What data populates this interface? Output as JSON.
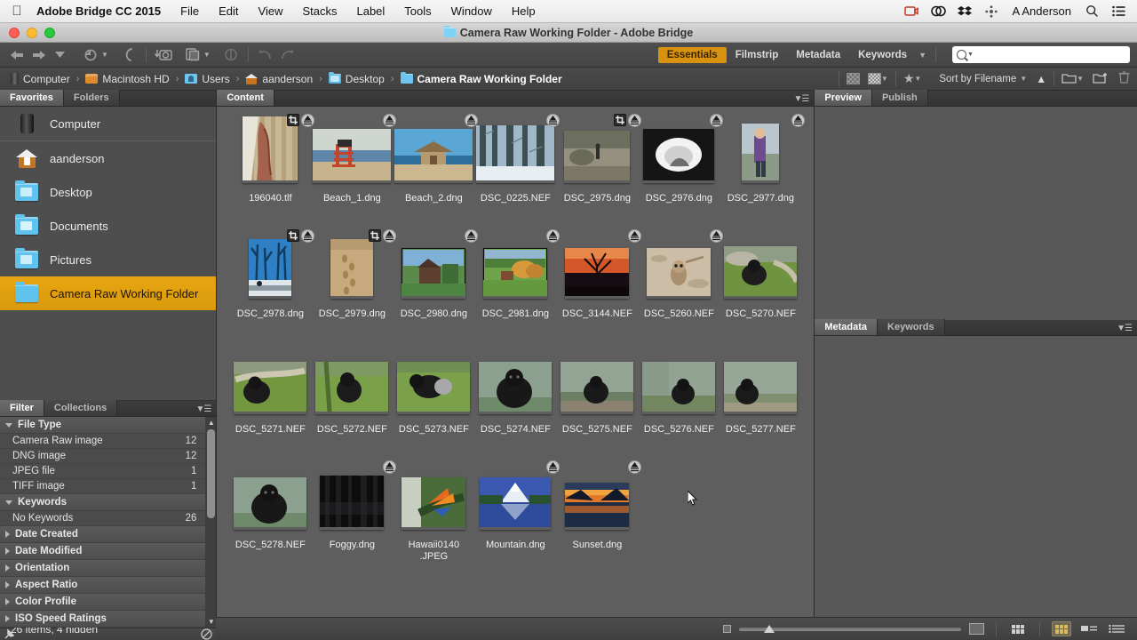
{
  "menubar": {
    "apple_icon": "apple-icon",
    "app_name": "Adobe Bridge CC 2015",
    "items": [
      "File",
      "Edit",
      "View",
      "Stacks",
      "Label",
      "Tools",
      "Window",
      "Help"
    ],
    "status_icons": [
      "video-capture-icon",
      "creative-cloud-icon",
      "dropbox-icon",
      "network-icon"
    ],
    "user": "A Anderson",
    "search_icon": "spotlight-search-icon",
    "notification_icon": "notification-center-icon"
  },
  "window": {
    "title": "Camera Raw Working Folder - Adobe Bridge",
    "folder_icon": "folder-icon",
    "close_label": "close-button",
    "minimize_label": "minimize-button",
    "zoom_label": "zoom-button"
  },
  "toolbar": {
    "back_icon": "back-arrow-icon",
    "forward_icon": "forward-arrow-icon",
    "recent_icon": "recent-dropdown-icon",
    "revert_icon": "revert-icon",
    "boomerang_icon": "return-icon",
    "camera_icon": "get-photos-from-camera-icon",
    "refine_icon": "refine-icon",
    "rotate_ccw_icon": "rotate-counterclockwise-icon",
    "rotate_cw_icon": "rotate-clockwise-icon",
    "open_recent_icon": "open-recent-icon",
    "workspaces": [
      {
        "label": "Essentials",
        "active": true
      },
      {
        "label": "Filmstrip",
        "active": false
      },
      {
        "label": "Metadata",
        "active": false
      },
      {
        "label": "Keywords",
        "active": false
      }
    ],
    "workspace_more_icon": "chevron-down-icon",
    "search_placeholder": "",
    "search_value": "",
    "search_icon": "search-icon"
  },
  "pathbar": {
    "crumbs": [
      {
        "label": "Computer",
        "icon": "computer-icon"
      },
      {
        "label": "Macintosh HD",
        "icon": "harddrive-icon"
      },
      {
        "label": "Users",
        "icon": "users-folder-icon"
      },
      {
        "label": "aanderson",
        "icon": "home-icon"
      },
      {
        "label": "Desktop",
        "icon": "desktop-folder-icon"
      },
      {
        "label": "Camera Raw Working Folder",
        "icon": "folder-icon"
      }
    ],
    "separator": "›",
    "filter_icon": "filter-unrated-icon",
    "filter_dropdown_icon": "filter-dropdown-icon",
    "rating_icon": "star-rating-icon",
    "rating_dropdown_icon": "rating-dropdown-icon",
    "sort_label": "Sort by Filename",
    "sort_dropdown_icon": "chevron-down-icon",
    "sort_direction_icon": "ascending-arrow-icon",
    "new_folder_icon": "new-folder-icon",
    "open_in_icon": "open-in-icon",
    "delete_icon": "trash-icon"
  },
  "sidebar": {
    "tabs": [
      {
        "label": "Favorites",
        "active": true
      },
      {
        "label": "Folders",
        "active": false
      }
    ],
    "items": [
      {
        "label": "Computer",
        "icon": "computer-icon",
        "selected": false
      },
      {
        "label": "aanderson",
        "icon": "home-icon",
        "selected": false
      },
      {
        "label": "Desktop",
        "icon": "desktop-folder-icon",
        "selected": false
      },
      {
        "label": "Documents",
        "icon": "documents-folder-icon",
        "selected": false
      },
      {
        "label": "Pictures",
        "icon": "pictures-folder-icon",
        "selected": false
      },
      {
        "label": "Camera Raw Working Folder",
        "icon": "folder-icon",
        "selected": true
      }
    ]
  },
  "filter": {
    "tabs": [
      {
        "label": "Filter",
        "active": true
      },
      {
        "label": "Collections",
        "active": false
      }
    ],
    "menu_icon": "panel-menu-icon",
    "groups": [
      {
        "label": "File Type",
        "expanded": true,
        "rows": [
          {
            "label": "Camera Raw image",
            "count": "12"
          },
          {
            "label": "DNG image",
            "count": "12"
          },
          {
            "label": "JPEG file",
            "count": "1"
          },
          {
            "label": "TIFF image",
            "count": "1"
          }
        ]
      },
      {
        "label": "Keywords",
        "expanded": true,
        "rows": [
          {
            "label": "No Keywords",
            "count": "26"
          }
        ]
      },
      {
        "label": "Date Created",
        "expanded": false,
        "rows": []
      },
      {
        "label": "Date Modified",
        "expanded": false,
        "rows": []
      },
      {
        "label": "Orientation",
        "expanded": false,
        "rows": []
      },
      {
        "label": "Aspect Ratio",
        "expanded": false,
        "rows": []
      },
      {
        "label": "Color Profile",
        "expanded": false,
        "rows": []
      },
      {
        "label": "ISO Speed Ratings",
        "expanded": false,
        "rows": []
      }
    ],
    "keep_filter_icon": "keep-filter-pin-icon",
    "clear_filter_icon": "clear-filter-icon"
  },
  "content": {
    "tabs": [
      {
        "label": "Content",
        "active": true
      }
    ],
    "menu_icon": "panel-menu-icon",
    "files": [
      {
        "name": "196040.tlf",
        "badges": [
          "crop",
          "raw"
        ]
      },
      {
        "name": "Beach_1.dng",
        "badges": [
          "raw"
        ]
      },
      {
        "name": "Beach_2.dng",
        "badges": [
          "raw"
        ]
      },
      {
        "name": "DSC_0225.NEF",
        "badges": [
          "raw"
        ]
      },
      {
        "name": "DSC_2975.dng",
        "badges": [
          "crop",
          "raw"
        ]
      },
      {
        "name": "DSC_2976.dng",
        "badges": [
          "raw"
        ]
      },
      {
        "name": "DSC_2977.dng",
        "badges": [
          "raw"
        ]
      },
      {
        "name": "DSC_2978.dng",
        "badges": [
          "crop",
          "raw"
        ]
      },
      {
        "name": "DSC_2979.dng",
        "badges": [
          "crop",
          "raw"
        ]
      },
      {
        "name": "DSC_2980.dng",
        "badges": [
          "raw"
        ]
      },
      {
        "name": "DSC_2981.dng",
        "badges": [
          "raw"
        ]
      },
      {
        "name": "DSC_3144.NEF",
        "badges": [
          "raw"
        ]
      },
      {
        "name": "DSC_5260.NEF",
        "badges": [
          "raw"
        ]
      },
      {
        "name": "DSC_5270.NEF",
        "badges": []
      },
      {
        "name": "DSC_5271.NEF",
        "badges": []
      },
      {
        "name": "DSC_5272.NEF",
        "badges": []
      },
      {
        "name": "DSC_5273.NEF",
        "badges": []
      },
      {
        "name": "DSC_5274.NEF",
        "badges": []
      },
      {
        "name": "DSC_5275.NEF",
        "badges": []
      },
      {
        "name": "DSC_5276.NEF",
        "badges": []
      },
      {
        "name": "DSC_5277.NEF",
        "badges": []
      },
      {
        "name": "DSC_5278.NEF",
        "badges": []
      },
      {
        "name": "Foggy.dng",
        "badges": [
          "raw"
        ]
      },
      {
        "name": "Hawaii0140\n.JPEG",
        "badges": []
      },
      {
        "name": "Mountain.dng",
        "badges": [
          "raw"
        ]
      },
      {
        "name": "Sunset.dng",
        "badges": [
          "raw"
        ]
      }
    ]
  },
  "preview": {
    "tabs": [
      {
        "label": "Preview",
        "active": true
      },
      {
        "label": "Publish",
        "active": false
      }
    ]
  },
  "metadata": {
    "tabs": [
      {
        "label": "Metadata",
        "active": true
      },
      {
        "label": "Keywords",
        "active": false
      }
    ],
    "menu_icon": "panel-menu-icon"
  },
  "status": {
    "items_text": "26 items, 4 hidden",
    "small_thumb_icon": "small-thumbnail-icon",
    "large_thumb_icon": "large-thumbnail-icon",
    "zoom_slider_icon": "thumbnail-size-slider",
    "view_lock_icon": "lock-view-icon",
    "view_grid_icon": "grid-view-icon",
    "view_details_icon": "details-view-icon",
    "view_list_icon": "list-view-icon"
  },
  "colors": {
    "accent": "#d8920f",
    "selection": "#e8a511",
    "panel_bg": "#4b4b4b",
    "content_bg": "#5e5e5e"
  }
}
